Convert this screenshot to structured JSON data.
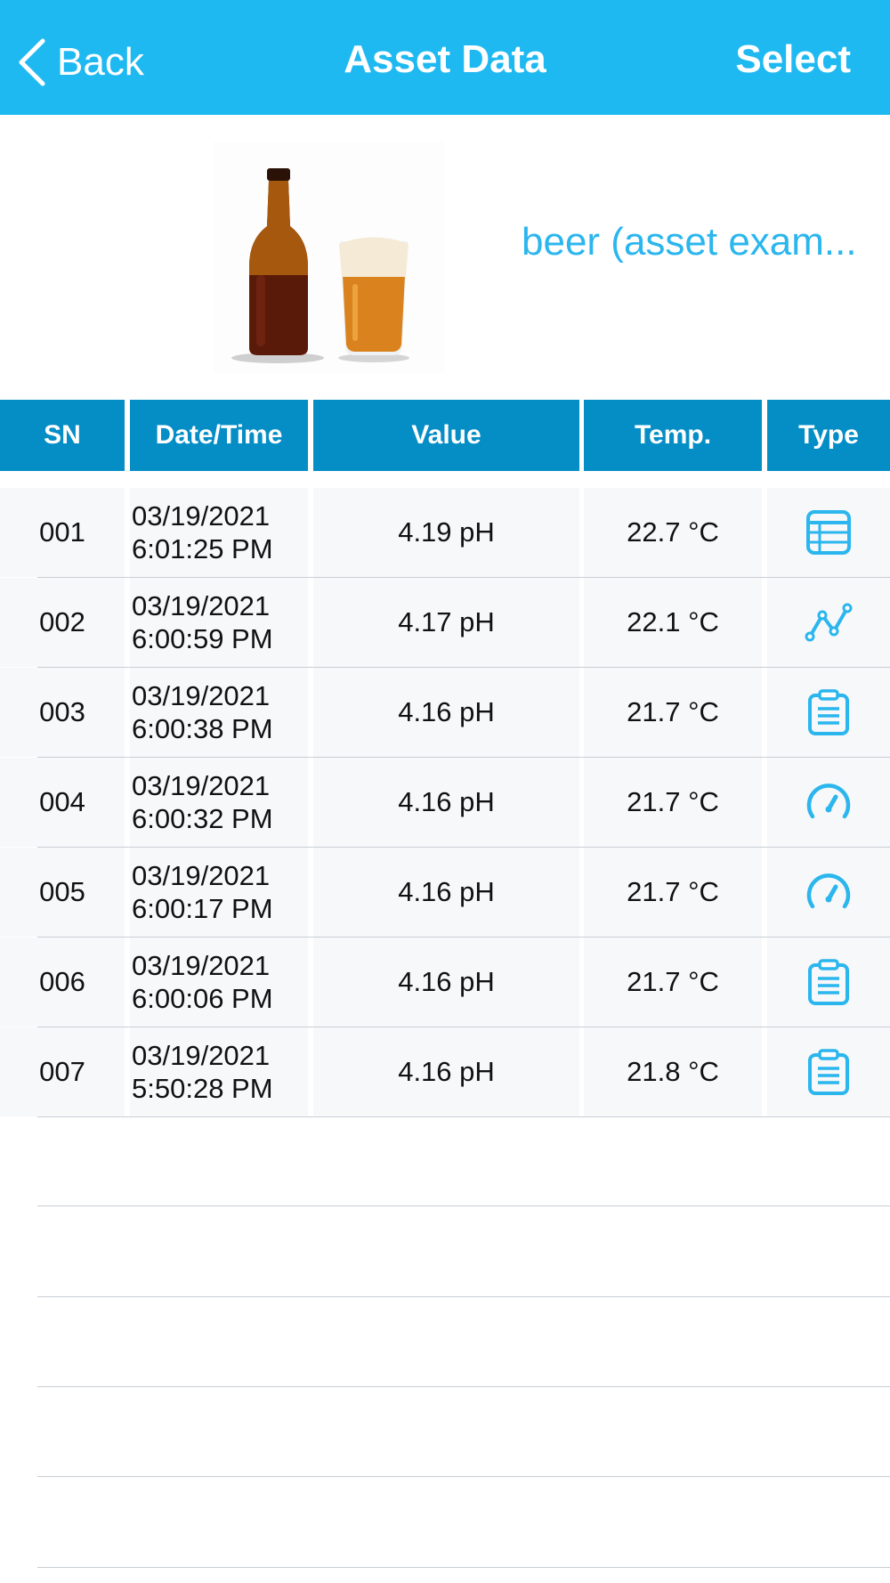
{
  "nav": {
    "back_label": "Back",
    "title": "Asset Data",
    "select_label": "Select"
  },
  "asset": {
    "name": "beer (asset exam..."
  },
  "table": {
    "headers": {
      "sn": "SN",
      "datetime": "Date/Time",
      "value": "Value",
      "temp": "Temp.",
      "type": "Type"
    },
    "rows": [
      {
        "sn": "001",
        "date": "03/19/2021",
        "time": "6:01:25 PM",
        "value": "4.19 pH",
        "temp": "22.7 °C",
        "type": "table-icon"
      },
      {
        "sn": "002",
        "date": "03/19/2021",
        "time": "6:00:59 PM",
        "value": "4.17 pH",
        "temp": "22.1 °C",
        "type": "graph-icon"
      },
      {
        "sn": "003",
        "date": "03/19/2021",
        "time": "6:00:38 PM",
        "value": "4.16 pH",
        "temp": "21.7 °C",
        "type": "clipboard-icon"
      },
      {
        "sn": "004",
        "date": "03/19/2021",
        "time": "6:00:32 PM",
        "value": "4.16 pH",
        "temp": "21.7 °C",
        "type": "gauge-icon"
      },
      {
        "sn": "005",
        "date": "03/19/2021",
        "time": "6:00:17 PM",
        "value": "4.16 pH",
        "temp": "21.7 °C",
        "type": "gauge-icon"
      },
      {
        "sn": "006",
        "date": "03/19/2021",
        "time": "6:00:06 PM",
        "value": "4.16 pH",
        "temp": "21.7 °C",
        "type": "clipboard-icon"
      },
      {
        "sn": "007",
        "date": "03/19/2021",
        "time": "5:50:28 PM",
        "value": "4.16 pH",
        "temp": "21.8 °C",
        "type": "clipboard-icon"
      }
    ]
  },
  "colors": {
    "nav_bg": "#1fb9f2",
    "header_bg": "#058ec6",
    "accent": "#2bb6ee",
    "row_bg": "#f7f8fa"
  }
}
